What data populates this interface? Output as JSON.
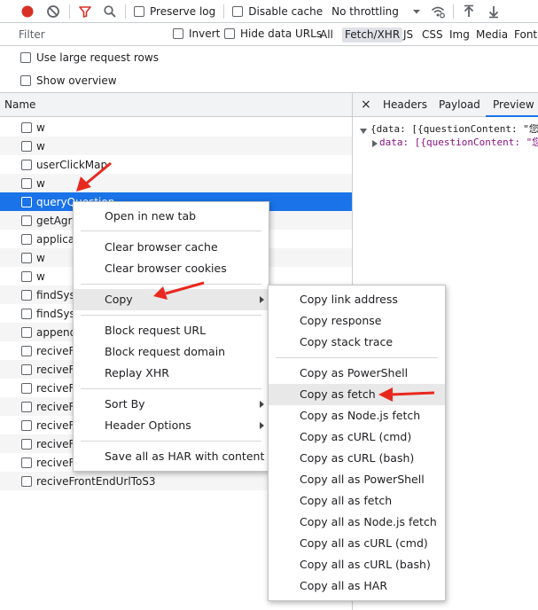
{
  "toolbar": {
    "record_icon": "record-icon",
    "clear_icon": "clear-icon",
    "filter_icon": "filter-icon",
    "search_icon": "search-icon",
    "preserve_log": "Preserve log",
    "disable_cache": "Disable cache",
    "throttling": "No throttling",
    "wifi_icon": "network-conditions-icon",
    "import_icon": "import-har-icon",
    "export_icon": "export-har-icon",
    "colors": {
      "record": "#d93025",
      "filter": "#d93025"
    }
  },
  "filterbar": {
    "placeholder": "Filter",
    "invert": "Invert",
    "hide_data_urls": "Hide data URLs",
    "types": [
      "All",
      "Fetch/XHR",
      "JS",
      "CSS",
      "Img",
      "Media",
      "Font"
    ]
  },
  "options": {
    "large_rows": "Use large request rows",
    "show_overview": "Show overview"
  },
  "requests": {
    "header": "Name",
    "rows": [
      "w",
      "w",
      "userClickMap",
      "w",
      "queryQuestion",
      "getAgre",
      "applicat",
      "w",
      "w",
      "findSysC",
      "findSysC",
      "append",
      "reciveFr",
      "reciveFr",
      "reciveFr",
      "reciveFr",
      "reciveFr",
      "reciveFr",
      "reciveFr",
      "reciveFrontEndUrlToS3"
    ]
  },
  "details": {
    "tabs": [
      "Headers",
      "Payload",
      "Preview"
    ],
    "close": "×",
    "preview_line1": "{data: [{questionContent: \"您",
    "preview_line2": "data: [{questionContent: \"您"
  },
  "context_menu": {
    "open_new_tab": "Open in new tab",
    "clear_cache": "Clear browser cache",
    "clear_cookies": "Clear browser cookies",
    "copy": "Copy",
    "block_url": "Block request URL",
    "block_domain": "Block request domain",
    "replay": "Replay XHR",
    "sort_by": "Sort By",
    "header_options": "Header Options",
    "save_har": "Save all as HAR with content"
  },
  "copy_submenu": {
    "items": [
      "Copy link address",
      "Copy response",
      "Copy stack trace",
      "Copy as PowerShell",
      "Copy as fetch",
      "Copy as Node.js fetch",
      "Copy as cURL (cmd)",
      "Copy as cURL (bash)",
      "Copy all as PowerShell",
      "Copy all as fetch",
      "Copy all as Node.js fetch",
      "Copy all as cURL (cmd)",
      "Copy all as cURL (bash)",
      "Copy all as HAR"
    ]
  },
  "annotation_color": "#e8281e"
}
